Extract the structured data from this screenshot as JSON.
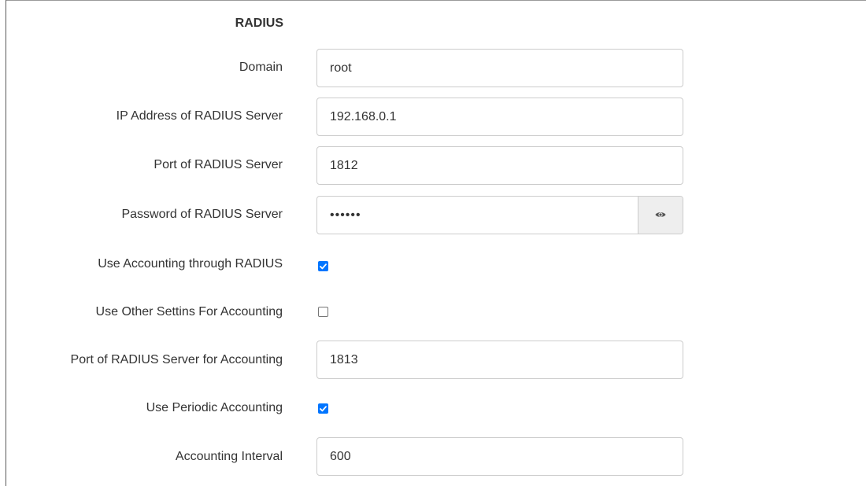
{
  "section": {
    "title": "RADIUS"
  },
  "fields": {
    "domain": {
      "label": "Domain",
      "value": "root"
    },
    "server_ip": {
      "label": "IP Address of RADIUS Server",
      "value": "192.168.0.1"
    },
    "server_port": {
      "label": "Port of RADIUS Server",
      "value": "1812"
    },
    "server_password": {
      "label": "Password of RADIUS Server",
      "value": "••••••",
      "toggle_icon": "eye-icon"
    },
    "use_accounting": {
      "label": "Use Accounting through RADIUS",
      "checked": true
    },
    "use_other_settings": {
      "label": "Use Other Settins For Accounting",
      "checked": false
    },
    "accounting_port": {
      "label": "Port of RADIUS Server for Accounting",
      "value": "1813"
    },
    "use_periodic_accounting": {
      "label": "Use Periodic Accounting",
      "checked": true
    },
    "accounting_interval": {
      "label": "Accounting Interval",
      "value": "600"
    }
  },
  "colors": {
    "checkbox_checked": "#0075ff",
    "input_border": "#cccccc",
    "addon_background": "#eeeeee",
    "label_text": "#333333"
  }
}
